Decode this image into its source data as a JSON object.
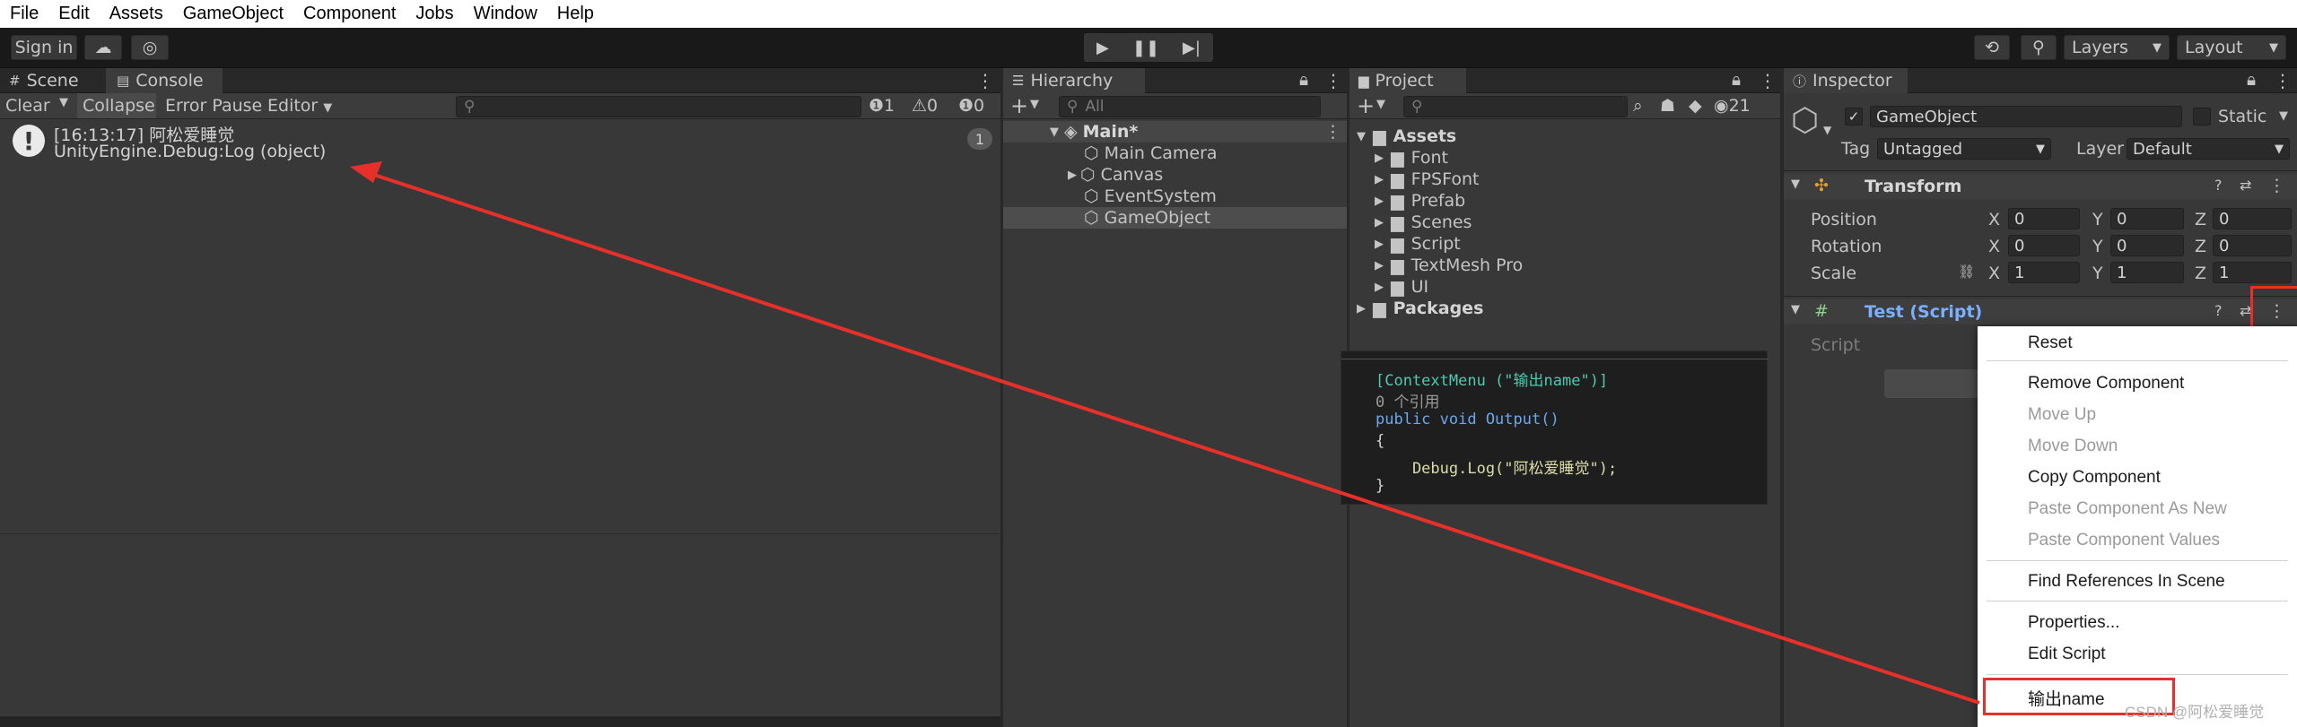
{
  "menu": [
    "File",
    "Edit",
    "Assets",
    "GameObject",
    "Component",
    "Jobs",
    "Window",
    "Help"
  ],
  "toolbar": {
    "sign_in": "Sign in",
    "layers": "Layers",
    "layout": "Layout"
  },
  "scene_tabs": {
    "scene": "Scene",
    "console": "Console"
  },
  "console": {
    "clear": "Clear",
    "collapse": "Collapse",
    "error_pause": "Error Pause",
    "editor": "Editor",
    "count_log": "1",
    "count_warn": "0",
    "count_err": "0",
    "log_time": "[16:13:17] 阿松爱睡觉",
    "log_detail": "UnityEngine.Debug:Log (object)",
    "log_count": "1"
  },
  "hierarchy": {
    "title": "Hierarchy",
    "search_placeholder": "All",
    "scene": "Main*",
    "items": [
      "Main Camera",
      "Canvas",
      "EventSystem",
      "GameObject"
    ]
  },
  "project": {
    "title": "Project",
    "hidden_count": "21",
    "assets": "Assets",
    "folders": [
      "Font",
      "FPSFont",
      "Prefab",
      "Scenes",
      "Script",
      "TextMesh Pro",
      "UI"
    ],
    "packages": "Packages"
  },
  "code": {
    "lines": [
      "[ContextMenu (\"输出name\")]",
      "0 个引用",
      "public void Output()",
      "{",
      "    Debug.Log(\"阿松爱睡觉\");",
      "}"
    ]
  },
  "inspector": {
    "title": "Inspector",
    "object_name": "GameObject",
    "static": "Static",
    "tag_label": "Tag",
    "tag": "Untagged",
    "layer_label": "Layer",
    "layer": "Default",
    "transform": "Transform",
    "position": "Position",
    "rotation": "Rotation",
    "scale": "Scale",
    "x": "X",
    "y": "Y",
    "z": "Z",
    "pos": [
      "0",
      "0",
      "0"
    ],
    "rot": [
      "0",
      "0",
      "0"
    ],
    "scl": [
      "1",
      "1",
      "1"
    ],
    "script_comp": "Test (Script)",
    "script_label": "Script"
  },
  "context_menu": {
    "reset": "Reset",
    "remove": "Remove Component",
    "move_up": "Move Up",
    "move_down": "Move Down",
    "copy": "Copy Component",
    "paste_new": "Paste Component As New",
    "paste_values": "Paste Component Values",
    "find_refs": "Find References In Scene",
    "properties": "Properties...",
    "edit_script": "Edit Script",
    "custom": "输出name"
  },
  "watermark": "CSDN @阿松爱睡觉",
  "colors": {
    "accent_red": "#e8302a",
    "script_blue": "#7ab0ff",
    "menu_bg": "#ffffff"
  }
}
